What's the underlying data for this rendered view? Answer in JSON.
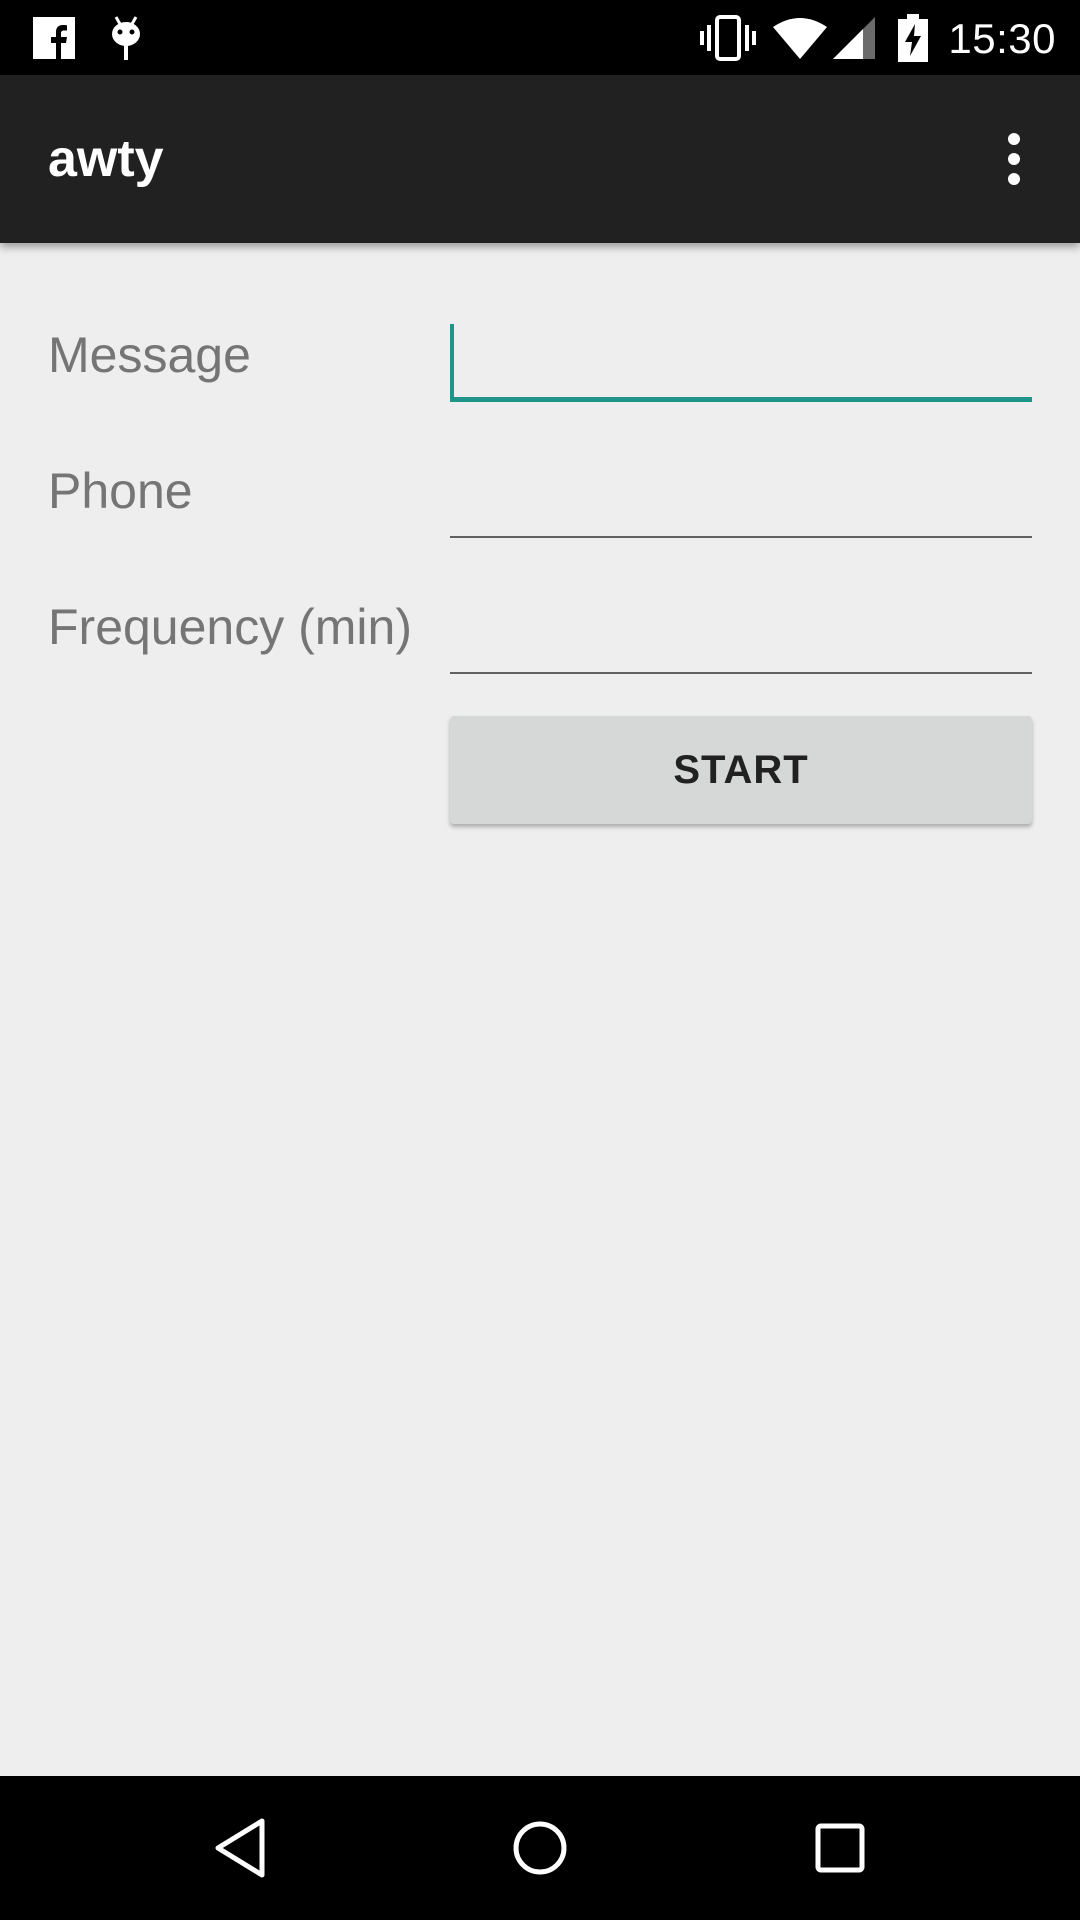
{
  "status_bar": {
    "time": "15:30",
    "left_icons": [
      "facebook-icon",
      "android-debug-icon"
    ],
    "right_icons": [
      "vibrate-icon",
      "wifi-icon",
      "cell-signal-icon",
      "battery-charging-icon"
    ]
  },
  "app_bar": {
    "title": "awty",
    "menu_icon": "overflow-menu-icon"
  },
  "form": {
    "message": {
      "label": "Message",
      "value": ""
    },
    "phone": {
      "label": "Phone",
      "value": ""
    },
    "frequency": {
      "label": "Frequency (min)",
      "value": ""
    },
    "start_label": "START"
  },
  "nav_bar": {
    "icons": [
      "back-icon",
      "home-icon",
      "recents-icon"
    ]
  },
  "colors": {
    "accent": "#1e9588",
    "app_bar": "#212121",
    "background": "#eeeeee",
    "label_text": "#757575",
    "button": "#d6d7d7"
  }
}
